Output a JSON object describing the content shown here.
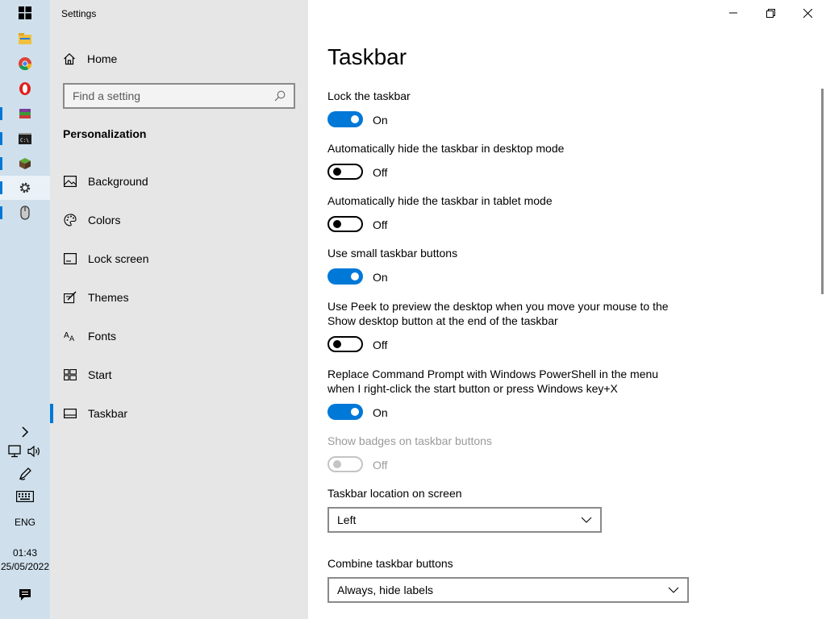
{
  "taskbar": {
    "apps": [
      "start-icon",
      "file-explorer-icon",
      "chrome-icon",
      "opera-icon",
      "winrar-icon",
      "cmd-icon",
      "minecraft-icon",
      "settings-icon",
      "mouse-icon"
    ],
    "tray": {
      "language": "ENG",
      "time": "01:43",
      "date": "25/05/2022"
    }
  },
  "window": {
    "title": "Settings"
  },
  "nav": {
    "home_label": "Home",
    "search_placeholder": "Find a setting",
    "section_title": "Personalization",
    "items": [
      {
        "label": "Background",
        "icon": "image-icon"
      },
      {
        "label": "Colors",
        "icon": "palette-icon"
      },
      {
        "label": "Lock screen",
        "icon": "lock-screen-icon"
      },
      {
        "label": "Themes",
        "icon": "themes-icon"
      },
      {
        "label": "Fonts",
        "icon": "fonts-icon"
      },
      {
        "label": "Start",
        "icon": "start-layout-icon"
      },
      {
        "label": "Taskbar",
        "icon": "taskbar-icon",
        "selected": true
      }
    ]
  },
  "main": {
    "title": "Taskbar",
    "settings": [
      {
        "label": "Lock the taskbar",
        "state": "On"
      },
      {
        "label": "Automatically hide the taskbar in desktop mode",
        "state": "Off"
      },
      {
        "label": "Automatically hide the taskbar in tablet mode",
        "state": "Off"
      },
      {
        "label": "Use small taskbar buttons",
        "state": "On"
      },
      {
        "label": "Use Peek to preview the desktop when you move your mouse to the Show desktop button at the end of the taskbar",
        "state": "Off"
      },
      {
        "label": "Replace Command Prompt with Windows PowerShell in the menu when I right-click the start button or press Windows key+X",
        "state": "On"
      },
      {
        "label": "Show badges on taskbar buttons",
        "state": "Off",
        "disabled": true
      }
    ],
    "location": {
      "label": "Taskbar location on screen",
      "value": "Left"
    },
    "combine": {
      "label": "Combine taskbar buttons",
      "value": "Always, hide labels"
    }
  },
  "colors": {
    "accent": "#0078d7",
    "nav_bg": "#e6e6e6",
    "taskbar_bg": "#cfe0ec"
  }
}
